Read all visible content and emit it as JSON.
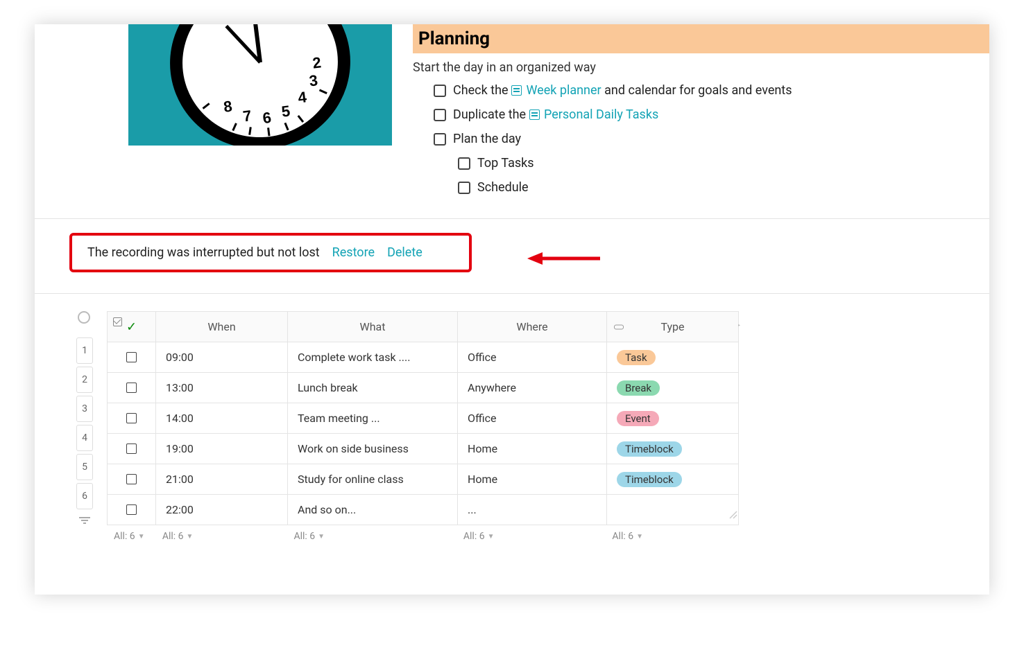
{
  "planning": {
    "title": "Planning",
    "subtitle": "Start the day in an organized way",
    "items": [
      {
        "before": "Check the ",
        "link": "Week planner",
        "after": " and calendar for goals and events"
      },
      {
        "before": "Duplicate the ",
        "link": "Personal Daily Tasks",
        "after": ""
      },
      {
        "before": "Plan the day",
        "link": "",
        "after": ""
      }
    ],
    "subItems": [
      "Top Tasks",
      "Schedule"
    ]
  },
  "notice": {
    "message": "The recording was interrupted but not lost",
    "restore": "Restore",
    "delete": "Delete"
  },
  "table": {
    "headers": {
      "when": "When",
      "what": "What",
      "where": "Where",
      "type": "Type"
    },
    "rows": [
      {
        "num": "1",
        "when": "09:00",
        "what": "Complete work task ....",
        "where": "Office",
        "type": "Task",
        "tagClass": "tag-task"
      },
      {
        "num": "2",
        "when": "13:00",
        "what": "Lunch break",
        "where": "Anywhere",
        "type": "Break",
        "tagClass": "tag-break"
      },
      {
        "num": "3",
        "when": "14:00",
        "what": "Team meeting ...",
        "where": "Office",
        "type": "Event",
        "tagClass": "tag-event"
      },
      {
        "num": "4",
        "when": "19:00",
        "what": "Work on side business",
        "where": "Home",
        "type": "Timeblock",
        "tagClass": "tag-timeblock"
      },
      {
        "num": "5",
        "when": "21:00",
        "what": "Study for online class",
        "where": "Home",
        "type": "Timeblock",
        "tagClass": "tag-timeblock"
      },
      {
        "num": "6",
        "when": "22:00",
        "what": "And so on...",
        "where": "...",
        "type": "",
        "tagClass": ""
      }
    ],
    "footer": "All: 6"
  }
}
